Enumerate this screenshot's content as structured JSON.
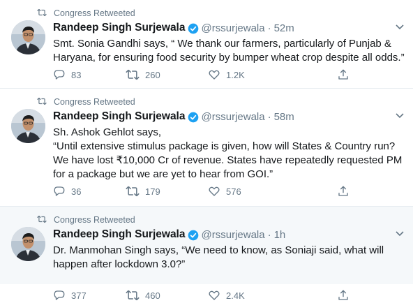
{
  "tweets": [
    {
      "retweeted_by": "Congress Retweeted",
      "author_name": "Randeep Singh Surjewala",
      "handle": "@rssurjewala",
      "separator": "·",
      "time": "52m",
      "text": "Smt. Sonia Gandhi says, “ We thank our farmers, particularly of Punjab &\nHaryana, for ensuring food security by bumper wheat crop despite all odds.”",
      "replies": "83",
      "retweets": "260",
      "likes": "1.2K"
    },
    {
      "retweeted_by": "Congress Retweeted",
      "author_name": "Randeep Singh Surjewala",
      "handle": "@rssurjewala",
      "separator": "·",
      "time": "58m",
      "text": "Sh. Ashok Gehlot says,\n“Until extensive stimulus package is given, how will States & Country run?\nWe have lost ₹10,000 Cr of revenue. States have repeatedly requested PM\nfor a package but we are yet to hear from GOI.”",
      "replies": "36",
      "retweets": "179",
      "likes": "576"
    },
    {
      "retweeted_by": "Congress Retweeted",
      "author_name": "Randeep Singh Surjewala",
      "handle": "@rssurjewala",
      "separator": "·",
      "time": "1h",
      "text": "Dr. Manmohan Singh says, “We need to know, as Soniaji said, what will\nhappen after lockdown 3.0?”",
      "replies": "377",
      "retweets": "460",
      "likes": "2.4K"
    }
  ],
  "colors": {
    "verified": "#1da1f2",
    "secondary_text": "#657786",
    "primary_text": "#14171a",
    "hover_background": "#f5f8fa"
  },
  "icons": [
    "retweet-icon",
    "verified-badge-icon",
    "chevron-down-icon",
    "reply-icon",
    "like-icon",
    "share-icon"
  ]
}
